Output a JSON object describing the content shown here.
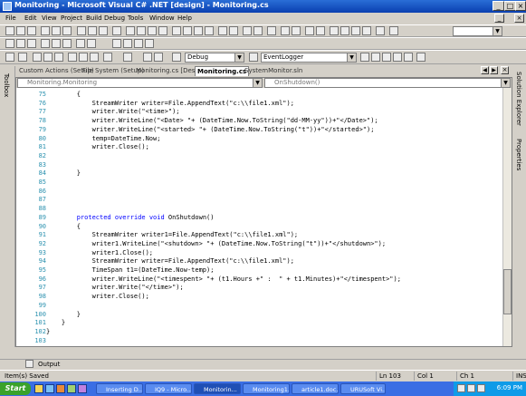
{
  "window": {
    "title": "Monitoring - Microsoft Visual C# .NET [design] - Monitoring.cs"
  },
  "menu": [
    "File",
    "Edit",
    "View",
    "Project",
    "Build",
    "Debug",
    "Tools",
    "Window",
    "Help"
  ],
  "toolbar": {
    "config": "Debug",
    "project": "EventLogger"
  },
  "tabs": [
    {
      "label": "Custom Actions (Setup)",
      "active": false
    },
    {
      "label": "File System (Setup)",
      "active": false
    },
    {
      "label": "Monitoring.cs [Design]",
      "active": false
    },
    {
      "label": "Monitoring.cs",
      "active": true
    },
    {
      "label": "SystemMonitor.sln",
      "active": false
    }
  ],
  "side": {
    "left": "Toolbox",
    "right_top": "Solution Explorer",
    "right_bottom": "Properties"
  },
  "nav": {
    "class": "Monitoring.Monitoring",
    "member": "OnShutdown()"
  },
  "code": [
    {
      "n": "75",
      "t": "        {"
    },
    {
      "n": "76",
      "t": "            StreamWriter writer=File.AppendText(\"c:\\\\file1.xml\");"
    },
    {
      "n": "77",
      "t": "            writer.Write(\"<time>\");"
    },
    {
      "n": "78",
      "t": "            writer.WriteLine(\"<Date> \"+ (DateTime.Now.ToString(\"dd-MM-yy\"))+\"</Date>\");"
    },
    {
      "n": "79",
      "t": "            writer.WriteLine(\"<started> \"+ (DateTime.Now.ToString(\"t\"))+\"</started>\");"
    },
    {
      "n": "80",
      "t": "            temp=DateTime.Now;"
    },
    {
      "n": "81",
      "t": "            writer.Close();"
    },
    {
      "n": "82",
      "t": ""
    },
    {
      "n": "83",
      "t": ""
    },
    {
      "n": "84",
      "t": "        }"
    },
    {
      "n": "85",
      "t": ""
    },
    {
      "n": "86",
      "t": ""
    },
    {
      "n": "87",
      "t": ""
    },
    {
      "n": "88",
      "t": ""
    },
    {
      "n": "89",
      "t": "        protected override void OnShutdown()"
    },
    {
      "n": "90",
      "t": "        {"
    },
    {
      "n": "91",
      "t": "            StreamWriter writer1=File.AppendText(\"c:\\\\file1.xml\");"
    },
    {
      "n": "92",
      "t": "            writer1.WriteLine(\"<shutdown> \"+ (DateTime.Now.ToString(\"t\"))+\"</shutdown>\");"
    },
    {
      "n": "93",
      "t": "            writer1.Close();"
    },
    {
      "n": "94",
      "t": "            StreamWriter writer=File.AppendText(\"c:\\\\file1.xml\");"
    },
    {
      "n": "95",
      "t": "            TimeSpan t1=(DateTime.Now-temp);"
    },
    {
      "n": "96",
      "t": "            writer.WriteLine(\"<timespent> \"+ (t1.Hours +\" :  \" + t1.Minutes)+\"</timespent>\");"
    },
    {
      "n": "97",
      "t": "            writer.Write(\"</time>\");"
    },
    {
      "n": "98",
      "t": "            writer.Close();"
    },
    {
      "n": "99",
      "t": ""
    },
    {
      "n": "100",
      "t": "        }"
    },
    {
      "n": "101",
      "t": "    }"
    },
    {
      "n": "102",
      "t": "}"
    },
    {
      "n": "103",
      "t": ""
    }
  ],
  "output": {
    "label": "Output"
  },
  "status": {
    "message": "Item(s) Saved",
    "ln": "Ln 103",
    "col": "Col 1",
    "ch": "Ch 1",
    "mode": "INS"
  },
  "taskbar": {
    "start": "Start",
    "buttons": [
      "Inserting D...",
      "IQ9 - Micro...",
      "Monitorin...",
      "Monitoring1...",
      "article1.doc...",
      "URUSoft Vi..."
    ],
    "clock": "6:09 PM"
  }
}
